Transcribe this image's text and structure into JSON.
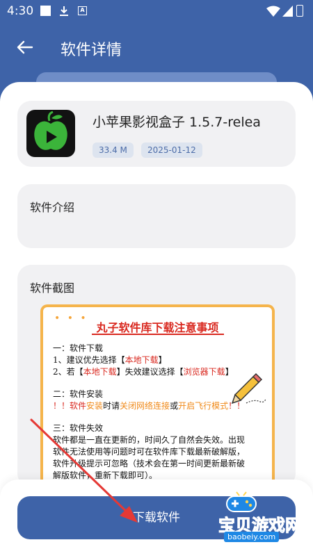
{
  "status_bar": {
    "time": "4:30",
    "icons": [
      "notification-square-icon",
      "download-icon",
      "a-badge-icon",
      "wifi-icon",
      "signal-icon",
      "battery-icon"
    ]
  },
  "header": {
    "title": "软件详情",
    "back_icon": "back-arrow-icon",
    "color": "#3e63a8"
  },
  "app": {
    "name": "小苹果影视盒子 1.5.7-relea",
    "size": "33.4 M",
    "date": "2025-01-12",
    "icon": "green-apple-play-icon"
  },
  "sections": {
    "intro_title": "软件介绍",
    "screenshots_title": "软件截图"
  },
  "screenshot": {
    "dots": "• • •",
    "title": "丸子软件库下载注意事项",
    "l1": "一：软件下载",
    "l2a": "1、建议优先选择【",
    "l2b": "本地下载",
    "l2c": "】",
    "l3a": "2、若【",
    "l3b": "本地下载",
    "l3c": "】失效建议选择【",
    "l3d": "浏览器下载",
    "l3e": "】",
    "l4": "二：软件安装",
    "l5a": "！！软件",
    "l5b": "安装",
    "l5c": "时请",
    "l5d": "关闭网络连接",
    "l5e": "或",
    "l5f": "开启飞行模式",
    "l5g": "！！",
    "l6": "三：软件失效",
    "l7": "软件都是一直在更新的，时间久了自然会失效。出现",
    "l8": "软件无法使用等问题时可在软件库下载最新破解版，",
    "l9": "软件升级提示可忽略（技术会在第一时间更新最新破",
    "l10": "解版软件，重新下载即可）。"
  },
  "actions": {
    "download_label": "下载软件"
  },
  "watermark": {
    "text": "宝贝游戏网",
    "url": "baobeiy.com"
  },
  "colors": {
    "accent": "#3e63a8",
    "badge_bg": "#dde4ef",
    "highlight_red": "#d9281f",
    "highlight_orange": "#f08b1c",
    "frame_orange": "#f5b44b"
  }
}
